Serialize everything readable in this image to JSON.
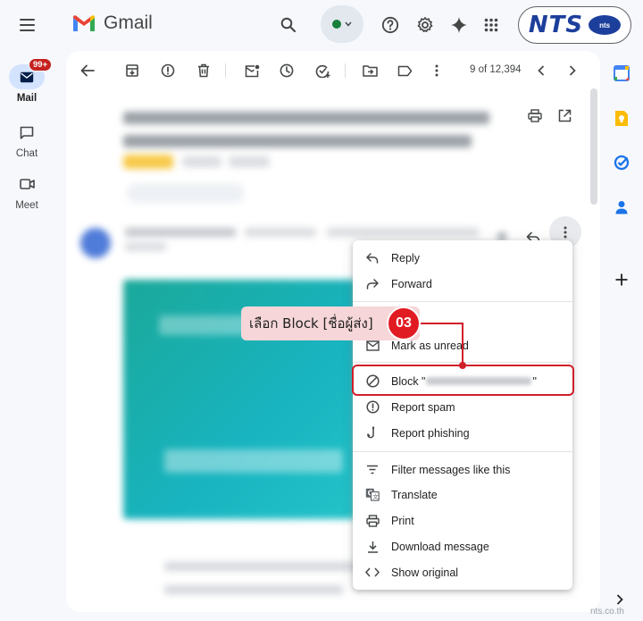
{
  "header": {
    "app_name": "Gmail"
  },
  "left_rail": {
    "items": [
      {
        "label": "Mail",
        "badge": "99+"
      },
      {
        "label": "Chat"
      },
      {
        "label": "Meet"
      }
    ]
  },
  "brand": {
    "logo_text": "NTS",
    "logo_small": "nts"
  },
  "toolbar": {
    "pager": "9 of 12,394"
  },
  "menu": {
    "items": [
      {
        "label": "Reply",
        "icon": "reply-icon"
      },
      {
        "label": "Forward",
        "icon": "forward-icon"
      },
      {
        "label": "Mark as unread",
        "icon": "mark-unread-icon"
      },
      {
        "label_prefix": "Block \"",
        "label_suffix": "\"",
        "icon": "block-icon"
      },
      {
        "label": "Report spam",
        "icon": "report-spam-icon"
      },
      {
        "label": "Report phishing",
        "icon": "phishing-hook-icon"
      },
      {
        "label": "Filter messages like this",
        "icon": "filter-icon"
      },
      {
        "label": "Translate",
        "icon": "translate-icon"
      },
      {
        "label": "Print",
        "icon": "print-icon"
      },
      {
        "label": "Download message",
        "icon": "download-icon"
      },
      {
        "label": "Show original",
        "icon": "code-icon"
      }
    ]
  },
  "callout": {
    "text": "เลือก Block [ชื่อผู้ส่ง]",
    "step": "03"
  },
  "footer": {
    "watermark": "nts.co.th"
  },
  "colors": {
    "accent_red": "#d01f2a",
    "nts_blue": "#1d3f9c",
    "callout_bg": "#f6d6d8"
  }
}
